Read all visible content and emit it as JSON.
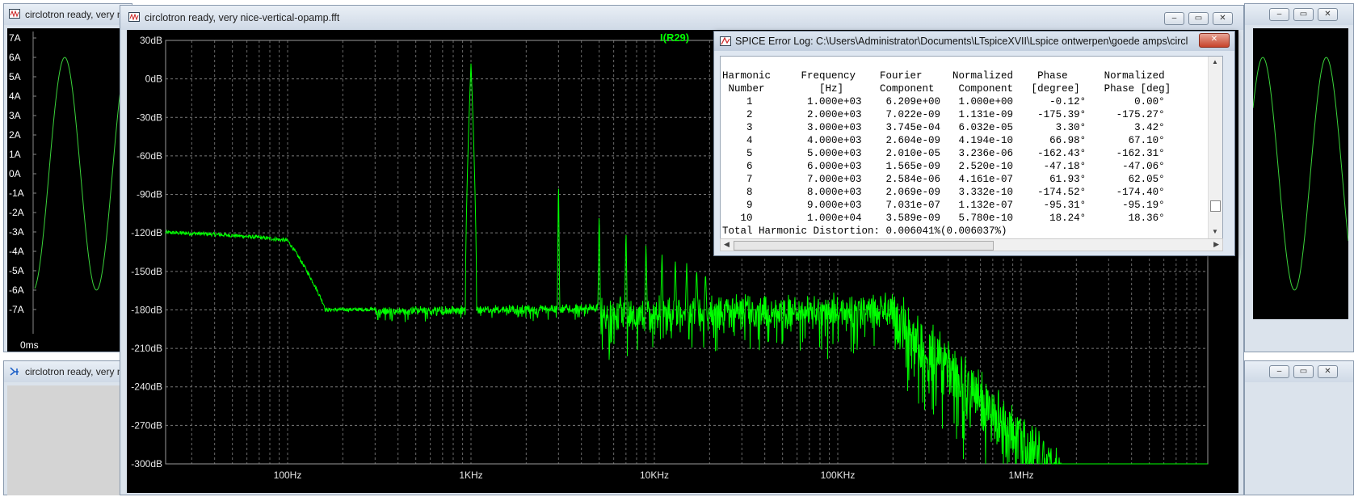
{
  "bg_window_left": {
    "title": "circlotron ready, very nic"
  },
  "bg_window_bottom": {
    "title": "circlotron ready, very nic"
  },
  "bg_plot": {
    "y_ticks": [
      "7A",
      "6A",
      "5A",
      "4A",
      "3A",
      "2A",
      "1A",
      "0A",
      "-1A",
      "-2A",
      "-3A",
      "-4A",
      "-5A",
      "-6A",
      "-7A"
    ],
    "x_first_tick": "0ms"
  },
  "main_window": {
    "title": "circlotron ready, very nice-vertical-opamp.fft"
  },
  "fft_plot": {
    "trace_label": "I(R29)",
    "trace_color": "#00ff00",
    "y_ticks": [
      "30dB",
      "0dB",
      "-30dB",
      "-60dB",
      "-90dB",
      "-120dB",
      "-150dB",
      "-180dB",
      "-210dB",
      "-240dB",
      "-270dB",
      "-300dB"
    ],
    "x_ticks": [
      "100Hz",
      "1KHz",
      "10KHz",
      "100KHz",
      "1MHz"
    ]
  },
  "error_log": {
    "title": "SPICE Error Log: C:\\Users\\Administrator\\Documents\\LTspiceXVII\\Lspice ontwerpen\\goede amps\\circlotro...",
    "header_line1": "Harmonic     Frequency    Fourier     Normalized    Phase      Normalized",
    "header_line2": " Number         [Hz]      Component    Component   [degree]    Phase [deg]",
    "rows": [
      "    1         1.000e+03    6.209e+00   1.000e+00      -0.12°        0.00°",
      "    2         2.000e+03    7.022e-09   1.131e-09    -175.39°     -175.27°",
      "    3         3.000e+03    3.745e-04   6.032e-05       3.30°        3.42°",
      "    4         4.000e+03    2.604e-09   4.194e-10      66.98°       67.10°",
      "    5         5.000e+03    2.010e-05   3.236e-06    -162.43°     -162.31°",
      "    6         6.000e+03    1.565e-09   2.520e-10     -47.18°      -47.06°",
      "    7         7.000e+03    2.584e-06   4.161e-07      61.93°       62.05°",
      "    8         8.000e+03    2.069e-09   3.332e-10    -174.52°     -174.40°",
      "    9         9.000e+03    7.031e-07   1.132e-07     -95.31°      -95.19°",
      "   10         1.000e+04    3.589e-09   5.780e-10      18.24°       18.36°"
    ],
    "thd_line": "Total Harmonic Distortion: 0.006041%(0.006037%)"
  },
  "buttons": {
    "minimize": "–",
    "maximize": "▭",
    "close": "✕"
  }
}
